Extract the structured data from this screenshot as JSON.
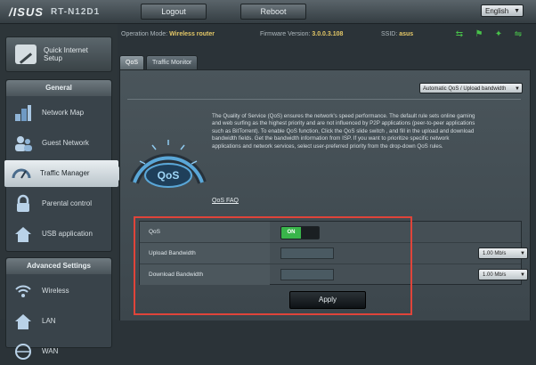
{
  "header": {
    "brand": "/ISUS",
    "product": "RT-N12D1",
    "logout_label": "Logout",
    "reboot_label": "Reboot",
    "language": "English"
  },
  "status": {
    "operation_mode_label": "Operation Mode:",
    "operation_mode_value": "Wireless router",
    "firmware_label": "Firmware Version:",
    "firmware_value": "3.0.0.3.108",
    "ssid_label": "SSID:",
    "ssid_value": "asus"
  },
  "sidebar": {
    "quick_setup_label": "Quick Internet Setup",
    "general_header": "General",
    "general_items": [
      {
        "label": "Network Map",
        "icon": "network-map-icon"
      },
      {
        "label": "Guest Network",
        "icon": "guest-network-icon"
      },
      {
        "label": "Traffic Manager",
        "icon": "traffic-manager-icon",
        "active": true
      },
      {
        "label": "Parental control",
        "icon": "parental-control-icon"
      },
      {
        "label": "USB application",
        "icon": "usb-application-icon"
      }
    ],
    "advanced_header": "Advanced Settings",
    "advanced_items": [
      {
        "label": "Wireless",
        "icon": "wireless-icon"
      },
      {
        "label": "LAN",
        "icon": "lan-icon"
      },
      {
        "label": "WAN",
        "icon": "wan-icon"
      }
    ]
  },
  "tabs": [
    {
      "label": "QoS",
      "active": true
    },
    {
      "label": "Traffic Monitor",
      "active": false
    }
  ],
  "panel": {
    "mode_select": "Automatic QoS / Upload bandwidth",
    "gauge_label": "QoS",
    "description": "The Quality of Service (QoS) ensures the network's speed performance. The default rule sets online gaming and web surfing as the highest priority and are not influenced by P2P applications (peer-to-peer applications such as BitTorrent). To enable QoS function, Click the QoS slide switch , and fill in the upload and download bandwidth fields. Get the bandwidth information from ISP. If you want to prioritize specific network applications and network services, select user-preferred priority from the drop-down QoS rules.",
    "faq_label": "QoS FAQ"
  },
  "settings": {
    "rows": [
      {
        "label": "QoS",
        "toggle": "ON"
      },
      {
        "label": "Upload Bandwidth",
        "value": "",
        "unit": "1.00 Mb/s"
      },
      {
        "label": "Download Bandwidth",
        "value": "",
        "unit": "1.00 Mb/s"
      }
    ],
    "apply_label": "Apply"
  },
  "colors": {
    "highlight": "#e0443a",
    "toggle_on": "#39b54a",
    "status_icon": "#48c24a"
  }
}
